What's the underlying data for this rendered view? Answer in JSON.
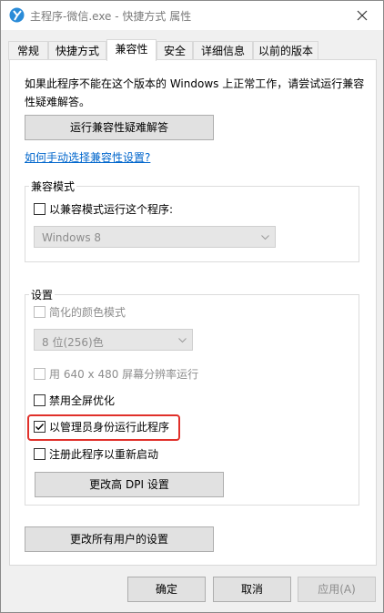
{
  "window": {
    "title": "主程序-微信.exe - 快捷方式 属性",
    "icon": "app-logo-icon",
    "close_icon": "close-icon"
  },
  "tabs": [
    {
      "label": "常规"
    },
    {
      "label": "快捷方式"
    },
    {
      "label": "兼容性",
      "active": true
    },
    {
      "label": "安全"
    },
    {
      "label": "详细信息"
    },
    {
      "label": "以前的版本"
    }
  ],
  "compat": {
    "intro": "如果此程序不能在这个版本的 Windows 上正常工作，请尝试运行兼容性疑难解答。",
    "troubleshoot_button": "运行兼容性疑难解答",
    "manual_link": "如何手动选择兼容性设置?",
    "mode_group": {
      "label": "兼容模式",
      "checkbox_label": "以兼容模式运行这个程序:",
      "checked": false,
      "os_select": "Windows 8"
    },
    "settings_group": {
      "label": "设置",
      "reduced_color": {
        "label": "简化的颜色模式",
        "checked": false,
        "disabled": true
      },
      "color_select": "8 位(256)色",
      "res_640": {
        "label": "用 640 x 480 屏幕分辨率运行",
        "checked": false,
        "disabled": true
      },
      "disable_fullscreen": {
        "label": "禁用全屏优化",
        "checked": false
      },
      "run_as_admin": {
        "label": "以管理员身份运行此程序",
        "checked": true
      },
      "register_restart": {
        "label": "注册此程序以重新启动",
        "checked": false
      },
      "dpi_button": "更改高 DPI 设置"
    },
    "all_users_button": "更改所有用户的设置"
  },
  "footer": {
    "ok": "确定",
    "cancel": "取消",
    "apply": "应用(A)"
  },
  "colors": {
    "highlight": "#e0302a",
    "link": "#0066cc",
    "app_icon": "#2a8bd8"
  }
}
